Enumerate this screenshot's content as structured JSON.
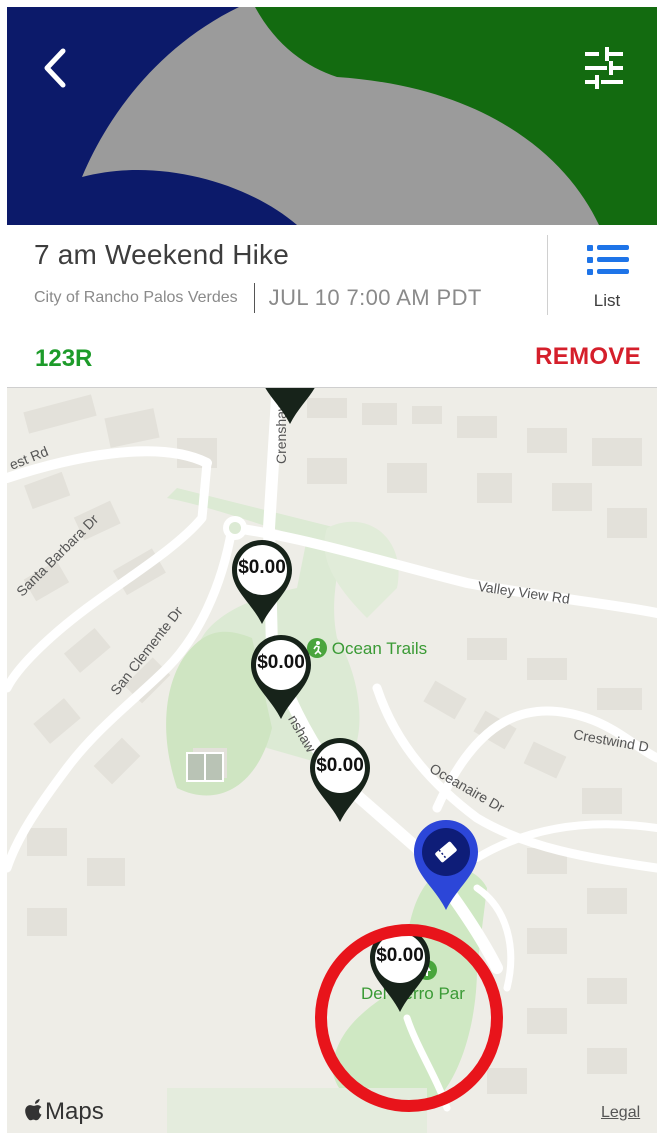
{
  "header": {
    "back_icon": "chevron-left-icon",
    "filter_icon": "sliders-icon",
    "banner_colors": {
      "navy": "#0c1a6a",
      "green": "#136b10",
      "gray": "#9b9b9b"
    }
  },
  "event": {
    "title": "7 am Weekend Hike",
    "organizer": "City of Rancho Palos Verdes",
    "datetime": "JUL 10 7:00 AM PDT",
    "list_label": "List",
    "list_icon": "list-icon"
  },
  "section": {
    "name": "123R",
    "remove_label": "REMOVE",
    "name_color": "#1d9b2a",
    "remove_color": "#d51f2b"
  },
  "map": {
    "pins": [
      {
        "price": "$0.00"
      },
      {
        "price": "$0.00"
      },
      {
        "price": "$0.00"
      },
      {
        "price": "$0.00"
      }
    ],
    "pin_color": "#17231a",
    "ticket_pin_color": "#2c46d8",
    "ticket_pin_icon": "ticket-icon",
    "highlight_color": "#e8141b",
    "poi": {
      "ocean_trails": "Ocean Trails",
      "del_cerro": "Del Cerro Par"
    },
    "streets": {
      "crest": "est Rd",
      "santa_barbara": "Santa Barbara Dr",
      "san_clemente": "San Clemente Dr",
      "crenshaw_top": "Crenshaw",
      "crenshaw_mid": "nshaw",
      "valley_view": "Valley View Rd",
      "crestwind": "Crestwind D",
      "oceanaire": "Oceanaire Dr"
    },
    "attribution": "Maps",
    "legal": "Legal"
  }
}
